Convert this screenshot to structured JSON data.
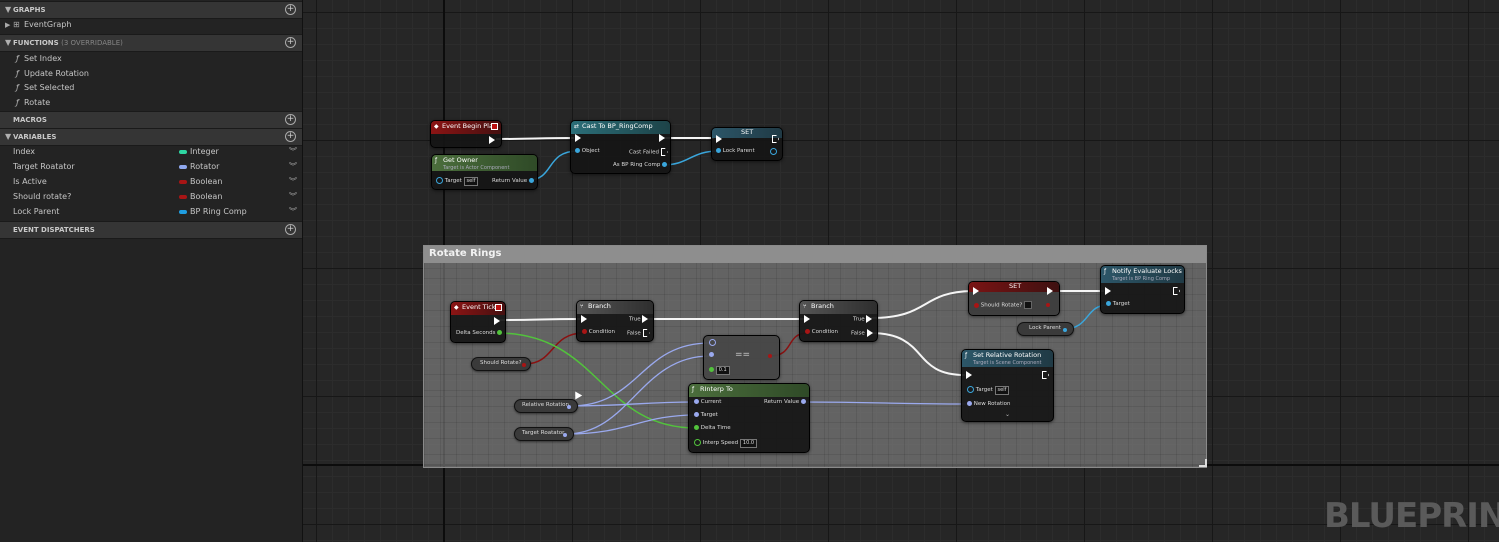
{
  "panel": {
    "graphs": {
      "title": "GRAPHS",
      "items": [
        "EventGraph"
      ]
    },
    "functions": {
      "title": "FUNCTIONS",
      "subtitle": "(3 OVERRIDABLE)",
      "items": [
        "Set Index",
        "Update Rotation",
        "Set Selected",
        "Rotate"
      ]
    },
    "macros": {
      "title": "MACROS"
    },
    "variables": {
      "title": "VARIABLES",
      "items": [
        {
          "name": "Index",
          "type": "Integer",
          "color": "#2ed6a2"
        },
        {
          "name": "Target Roatator",
          "type": "Rotator",
          "color": "#8fa8ee"
        },
        {
          "name": "Is Active",
          "type": "Boolean",
          "color": "#a81515"
        },
        {
          "name": "Should rotate?",
          "type": "Boolean",
          "color": "#a81515"
        },
        {
          "name": "Lock Parent",
          "type": "BP Ring Comp",
          "color": "#1f9de0"
        }
      ]
    },
    "dispatchers": {
      "title": "EVENT DISPATCHERS"
    }
  },
  "graph": {
    "watermark": "BLUEPRINT",
    "comment_title": "Rotate Rings",
    "nodes": {
      "begin_play": {
        "title": "Event Begin Play"
      },
      "get_owner": {
        "title": "Get Owner",
        "subtitle": "Target is Actor Component",
        "target": "Target",
        "target_value": "self",
        "return": "Return Value"
      },
      "cast": {
        "title": "Cast To BP_RingComp",
        "object": "Object",
        "failed": "Cast Failed",
        "as": "As BP Ring Comp"
      },
      "set_lock": {
        "title": "SET",
        "pin": "Lock Parent"
      },
      "event_tick": {
        "title": "Event Tick",
        "delta": "Delta Seconds"
      },
      "branch1": {
        "title": "Branch",
        "condition": "Condition",
        "true": "True",
        "false": "False"
      },
      "branch2": {
        "title": "Branch",
        "condition": "Condition",
        "true": "True",
        "false": "False"
      },
      "equals": {
        "symbol": "==",
        "tolerance": "0.1"
      },
      "rinterp": {
        "title": "RInterp To",
        "current": "Current",
        "target": "Target",
        "delta": "Delta Time",
        "speed": "Interp Speed",
        "speed_value": "10.0",
        "return": "Return Value"
      },
      "set_rotate": {
        "title": "SET",
        "pin": "Should Rotate?"
      },
      "notify": {
        "title": "Notify Evaluate Locks",
        "subtitle": "Target is BP Ring Comp",
        "target": "Target"
      },
      "set_rel_rot": {
        "title": "Set Relative Rotation",
        "subtitle": "Target is Scene Component",
        "target": "Target",
        "target_value": "self",
        "new_rot": "New Rotation"
      }
    },
    "vars": {
      "should_rotate": "Should Rotate?",
      "relative_rotation": "Relative Rotation",
      "target_roatator": "Target Roatator",
      "lock_parent": "Lock Parent"
    }
  }
}
